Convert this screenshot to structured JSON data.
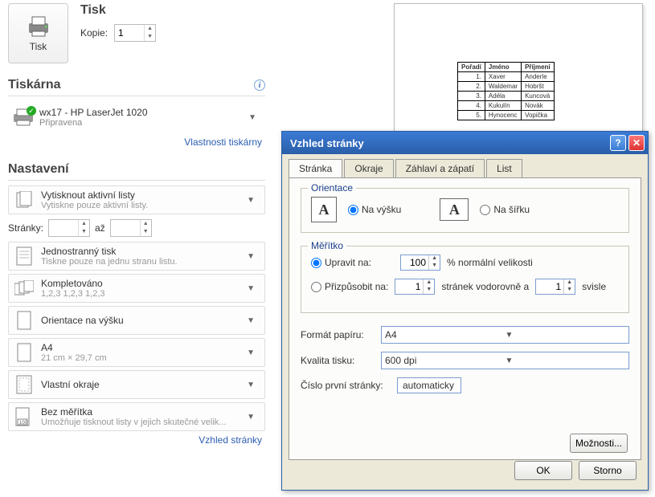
{
  "print": {
    "title": "Tisk",
    "copiesLabel": "Kopie:",
    "copiesValue": "1",
    "buttonLabel": "Tisk"
  },
  "printerSection": {
    "heading": "Tiskárna",
    "name": "wx17 - HP LaserJet 1020",
    "status": "Připravena",
    "propsLink": "Vlastnosti tiskárny"
  },
  "settings": {
    "heading": "Nastavení",
    "pagesLabel": "Stránky:",
    "pagesTo": "až",
    "pageSetupLink": "Vzhled stránky"
  },
  "opts": [
    {
      "t": "Vytisknout aktivní listy",
      "d": "Vytiskne pouze aktivní listy."
    },
    {
      "t": "Jednostranný tisk",
      "d": "Tiskne pouze na jednu stranu listu."
    },
    {
      "t": "Kompletováno",
      "d": "1,2,3   1,2,3   1,2,3"
    },
    {
      "t": "Orientace na výšku",
      "d": ""
    },
    {
      "t": "A4",
      "d": "21 cm × 29,7 cm"
    },
    {
      "t": "Vlastní okraje",
      "d": ""
    },
    {
      "t": "Bez měřítka",
      "d": "Umožňuje tisknout listy v jejich skutečné velik..."
    }
  ],
  "table": {
    "headers": [
      "Pořadí",
      "Jméno",
      "Příjmení"
    ],
    "rows": [
      [
        "1.",
        "Xaver",
        "Anderle"
      ],
      [
        "2.",
        "Waldemar",
        "Hobršt"
      ],
      [
        "3.",
        "Adéla",
        "Kuncová"
      ],
      [
        "4.",
        "Kukulín",
        "Novák"
      ],
      [
        "5.",
        "Hynocenc",
        "Vopička"
      ]
    ]
  },
  "dialog": {
    "title": "Vzhled stránky",
    "tabs": [
      "Stránka",
      "Okraje",
      "Záhlaví a zápatí",
      "List"
    ],
    "orient": {
      "legend": "Orientace",
      "portrait": "Na výšku",
      "landscape": "Na šířku"
    },
    "scale": {
      "legend": "Měřítko",
      "adjust": "Upravit na:",
      "adjustVal": "100",
      "adjustSuffix": "% normální velikosti",
      "fit": "Přizpůsobit na:",
      "fitW": "1",
      "fitMid": "stránek vodorovně a",
      "fitH": "1",
      "fitEnd": "svisle"
    },
    "paperLabel": "Formát papíru:",
    "paperVal": "A4",
    "qualityLabel": "Kvalita tisku:",
    "qualityVal": "600 dpi",
    "firstPageLabel": "Číslo první stránky:",
    "firstPageVal": "automaticky",
    "optionsBtn": "Možnosti...",
    "ok": "OK",
    "cancel": "Storno"
  }
}
